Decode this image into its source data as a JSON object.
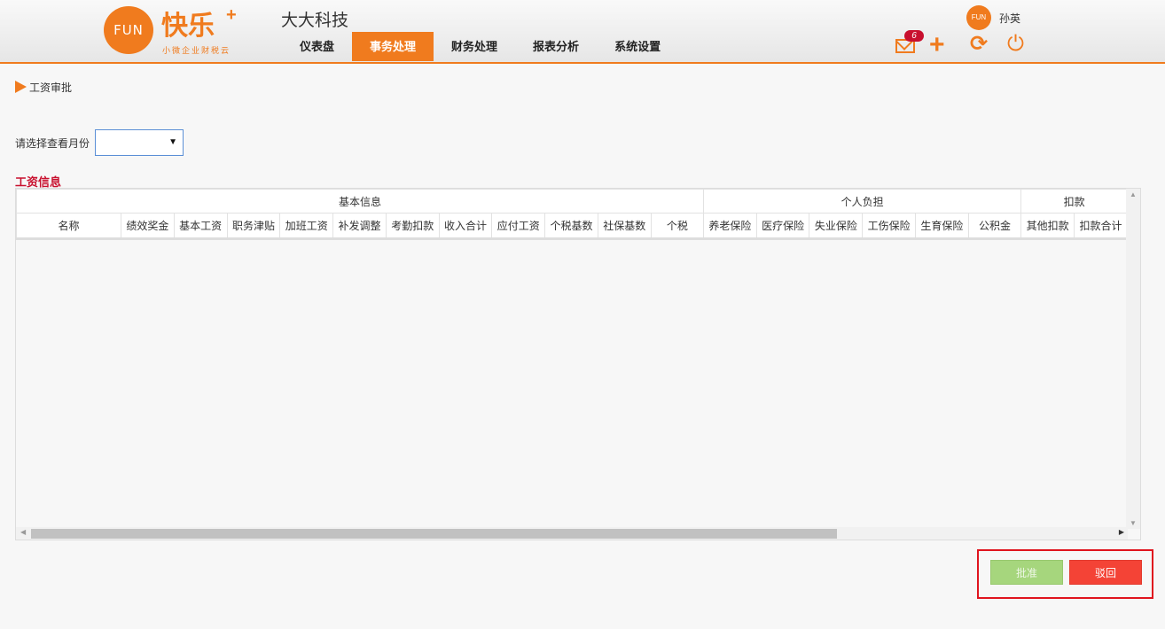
{
  "header": {
    "logo_mark": "FUN",
    "logo_title": "快乐",
    "logo_plus": "+",
    "logo_subtitle": "小微企业财税云",
    "company": "大大科技",
    "nav": [
      "仪表盘",
      "事务处理",
      "财务处理",
      "报表分析",
      "系统设置"
    ],
    "active_nav": "事务处理",
    "mail_badge": "6",
    "user_avatar": "FUN",
    "user_name": "孙英",
    "accent_color": "#f07b1e"
  },
  "breadcrumb": "工资审批",
  "month_filter": {
    "label": "请选择查看月份",
    "value": ""
  },
  "section_title": "工资信息",
  "table": {
    "groups": [
      {
        "label": "基本信息"
      },
      {
        "label": "个人负担"
      },
      {
        "label": "扣款"
      }
    ],
    "columns": [
      "名称",
      "绩效奖金",
      "基本工资",
      "职务津贴",
      "加班工资",
      "补发调整",
      "考勤扣款",
      "收入合计",
      "应付工资",
      "个税基数",
      "社保基数",
      "个税",
      "养老保险",
      "医疗保险",
      "失业保险",
      "工伤保险",
      "生育保险",
      "公积金",
      "其他扣款",
      "扣款合计"
    ],
    "rows": []
  },
  "actions": {
    "approve": "批准",
    "revoke": "驳回"
  }
}
